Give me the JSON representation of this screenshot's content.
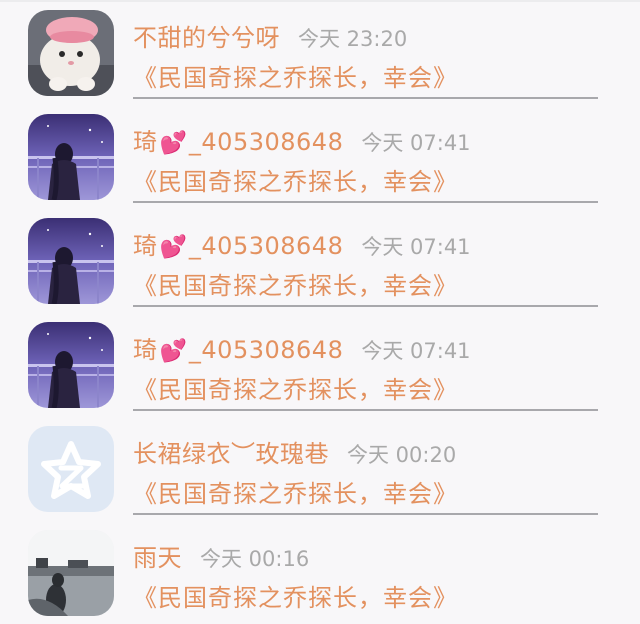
{
  "conversations": [
    {
      "name": "不甜的兮兮呀",
      "heart": "",
      "suffix": "",
      "time": "今天 23:20",
      "message": "《民国奇探之乔探长，幸会》",
      "avatar_icon": "cat-photo-avatar-icon"
    },
    {
      "name": "琦",
      "heart": "💕",
      "suffix": "_405308648",
      "time": "今天 07:41",
      "message": "《民国奇探之乔探长，幸会》",
      "avatar_icon": "girl-purple-photo-avatar-icon"
    },
    {
      "name": "琦",
      "heart": "💕",
      "suffix": "_405308648",
      "time": "今天 07:41",
      "message": "《民国奇探之乔探长，幸会》",
      "avatar_icon": "girl-purple-photo-avatar-icon"
    },
    {
      "name": "琦",
      "heart": "💕",
      "suffix": "_405308648",
      "time": "今天 07:41",
      "message": "《民国奇探之乔探长，幸会》",
      "avatar_icon": "girl-purple-photo-avatar-icon"
    },
    {
      "name": "长裙绿衣︶玫瑰巷",
      "heart": "",
      "suffix": "",
      "time": "今天 00:20",
      "message": "《民国奇探之乔探长，幸会》",
      "avatar_icon": "qq-star-default-avatar-icon"
    },
    {
      "name": "雨天",
      "heart": "",
      "suffix": "",
      "time": "今天 00:16",
      "message": "《民国奇探之乔探长，幸会》",
      "avatar_icon": "rainy-street-photo-avatar-icon"
    }
  ],
  "colors": {
    "accent": "#e3915f",
    "time": "#a9a9a9",
    "background": "#f8f7f9",
    "divider": "#a8a8ac",
    "heart": "#ef4f8a"
  }
}
